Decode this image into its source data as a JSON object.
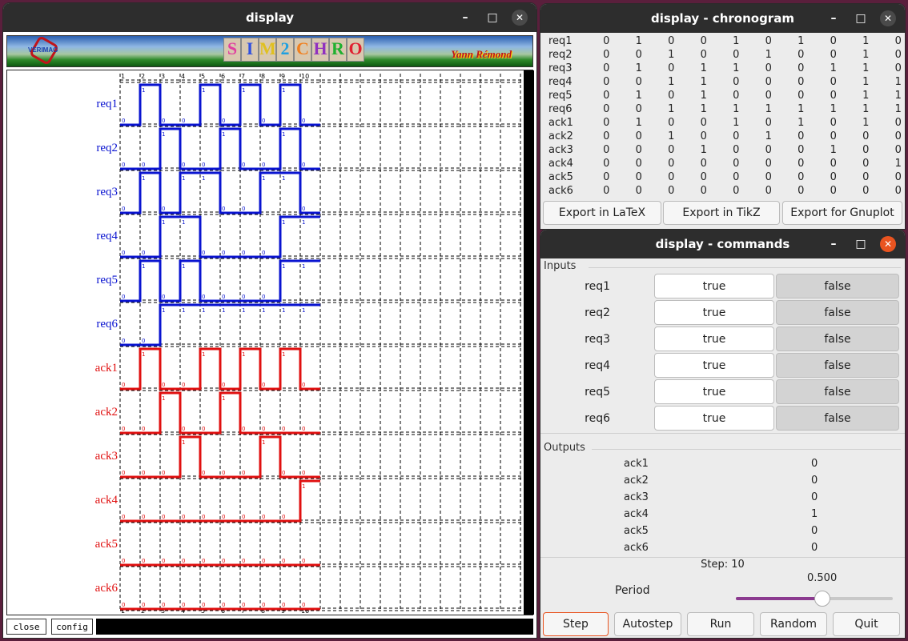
{
  "display": {
    "title": "display",
    "logo_text": "VERIMAG",
    "simchro_letters": [
      "S",
      "I",
      "M",
      "2",
      "C",
      "H",
      "R",
      "O"
    ],
    "simchro_colors": [
      "#e040a0",
      "#3050e0",
      "#e0c020",
      "#20a0e0",
      "#f08020",
      "#9030c0",
      "#20b030",
      "#e02030"
    ],
    "author": "Yann Rémond",
    "ticks": [
      "1",
      "2",
      "3",
      "4",
      "5",
      "6",
      "7",
      "8",
      "9",
      "10"
    ],
    "close_label": "close",
    "config_label": "config",
    "signal_colors": {
      "req": "#0a14d0",
      "ack": "#e01010"
    }
  },
  "chronogram": {
    "title": "display - chronogram",
    "rows": [
      {
        "name": "req1",
        "values": [
          0,
          1,
          0,
          0,
          1,
          0,
          1,
          0,
          1,
          0
        ]
      },
      {
        "name": "req2",
        "values": [
          0,
          0,
          1,
          0,
          0,
          1,
          0,
          0,
          1,
          0
        ]
      },
      {
        "name": "req3",
        "values": [
          0,
          1,
          0,
          1,
          1,
          0,
          0,
          1,
          1,
          0
        ]
      },
      {
        "name": "req4",
        "values": [
          0,
          0,
          1,
          1,
          0,
          0,
          0,
          0,
          1,
          1
        ]
      },
      {
        "name": "req5",
        "values": [
          0,
          1,
          0,
          1,
          0,
          0,
          0,
          0,
          1,
          1
        ]
      },
      {
        "name": "req6",
        "values": [
          0,
          0,
          1,
          1,
          1,
          1,
          1,
          1,
          1,
          1
        ]
      },
      {
        "name": "ack1",
        "values": [
          0,
          1,
          0,
          0,
          1,
          0,
          1,
          0,
          1,
          0
        ]
      },
      {
        "name": "ack2",
        "values": [
          0,
          0,
          1,
          0,
          0,
          1,
          0,
          0,
          0,
          0
        ]
      },
      {
        "name": "ack3",
        "values": [
          0,
          0,
          0,
          1,
          0,
          0,
          0,
          1,
          0,
          0
        ]
      },
      {
        "name": "ack4",
        "values": [
          0,
          0,
          0,
          0,
          0,
          0,
          0,
          0,
          0,
          1
        ]
      },
      {
        "name": "ack5",
        "values": [
          0,
          0,
          0,
          0,
          0,
          0,
          0,
          0,
          0,
          0
        ]
      },
      {
        "name": "ack6",
        "values": [
          0,
          0,
          0,
          0,
          0,
          0,
          0,
          0,
          0,
          0
        ]
      }
    ],
    "export_latex": "Export in LaTeX",
    "export_tikz": "Export in TikZ",
    "export_gnuplot": "Export for Gnuplot"
  },
  "commands": {
    "title": "display - commands",
    "inputs_label": "Inputs",
    "outputs_label": "Outputs",
    "inputs": [
      {
        "name": "req1",
        "true_label": "true",
        "false_label": "false"
      },
      {
        "name": "req2",
        "true_label": "true",
        "false_label": "false"
      },
      {
        "name": "req3",
        "true_label": "true",
        "false_label": "false"
      },
      {
        "name": "req4",
        "true_label": "true",
        "false_label": "false"
      },
      {
        "name": "req5",
        "true_label": "true",
        "false_label": "false"
      },
      {
        "name": "req6",
        "true_label": "true",
        "false_label": "false"
      }
    ],
    "outputs": [
      {
        "name": "ack1",
        "value": "0"
      },
      {
        "name": "ack2",
        "value": "0"
      },
      {
        "name": "ack3",
        "value": "0"
      },
      {
        "name": "ack4",
        "value": "1"
      },
      {
        "name": "ack5",
        "value": "0"
      },
      {
        "name": "ack6",
        "value": "0"
      }
    ],
    "step_text": "Step: 10",
    "period_label": "Period",
    "period_value": "0.500",
    "period_fraction": 0.55,
    "buttons": {
      "step": "Step",
      "autostep": "Autostep",
      "run": "Run",
      "random": "Random",
      "quit": "Quit"
    }
  },
  "window_controls": {
    "minimize": "–",
    "maximize": "□",
    "close": "✕"
  }
}
